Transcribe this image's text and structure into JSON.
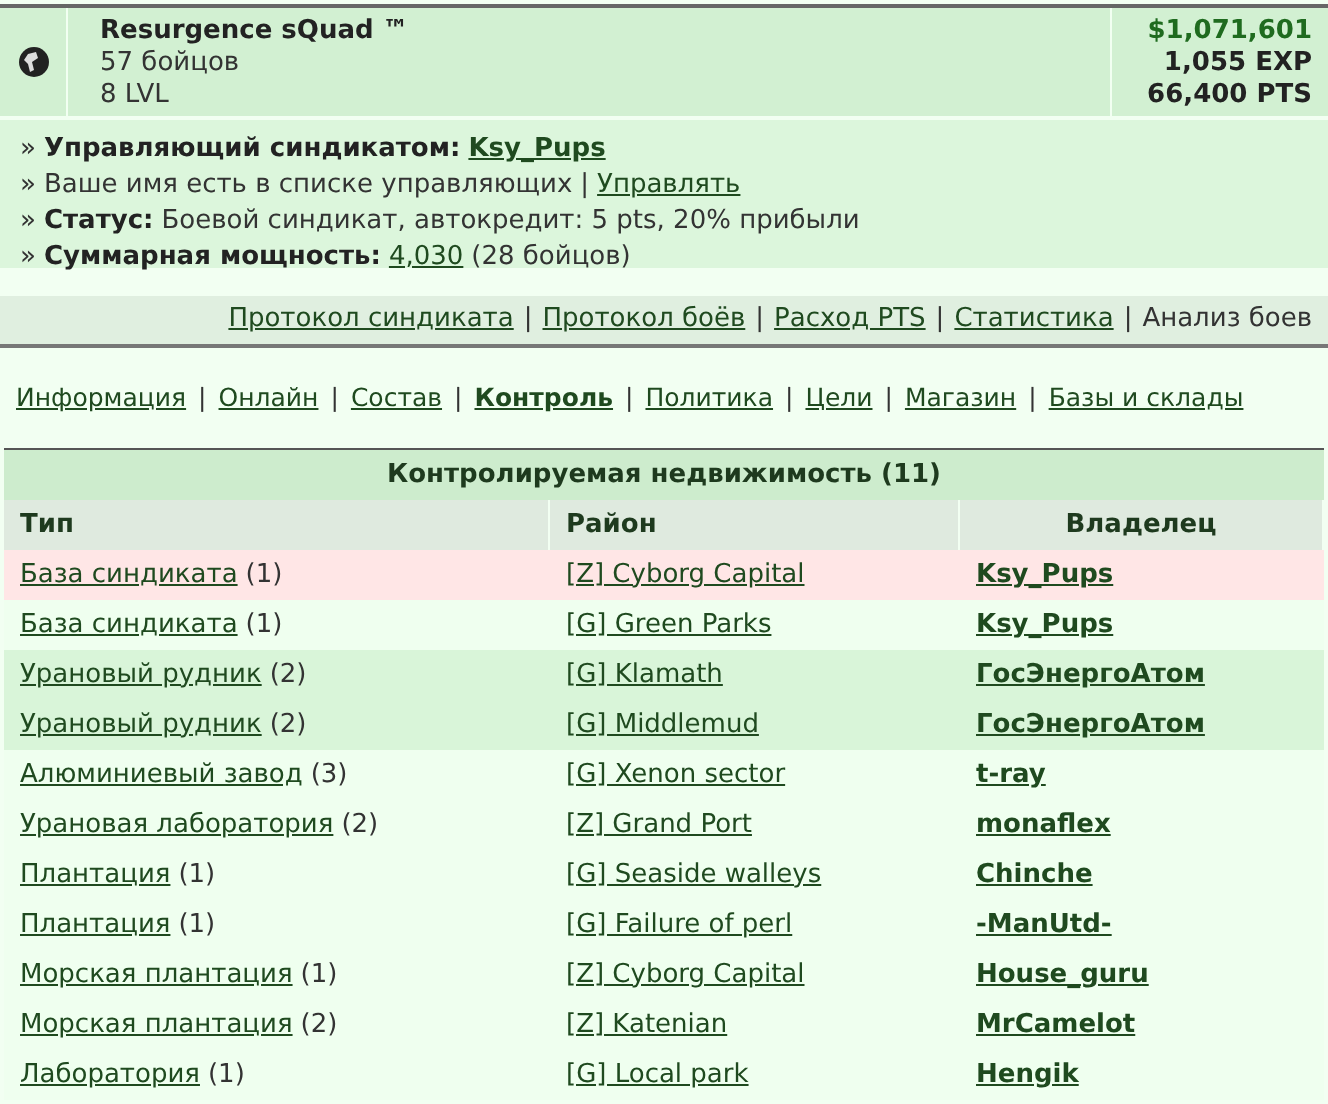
{
  "squad": {
    "name": "Resurgence sQuad ™",
    "fighters": "57 бойцов",
    "level": "8 LVL",
    "money": "$1,071,601",
    "exp": "1,055 EXP",
    "pts": "66,400 PTS"
  },
  "info": [
    {
      "kind": "manager",
      "bullet": "»",
      "label": "Управляющий синдикатом:",
      "link": "Ksy_Pups"
    },
    {
      "kind": "note",
      "bullet": "»",
      "text": "Ваше имя есть в списке управляющих",
      "separator": "|",
      "link": "Управлять"
    },
    {
      "kind": "status",
      "bullet": "»",
      "label": "Статус:",
      "text": "Боевой синдикат, автокредит: 5 pts, 20% прибыли"
    },
    {
      "kind": "power",
      "bullet": "»",
      "label": "Суммарная мощность:",
      "link": "4,030",
      "text": "(28 бойцов)"
    }
  ],
  "protocol_links": [
    {
      "label": "Протокол синдиката",
      "link": true
    },
    {
      "separator": "|",
      "label": "Протокол боёв",
      "link": true
    },
    {
      "separator": "|",
      "label": "Расход PTS",
      "link": true
    },
    {
      "separator": "|",
      "label": "Статистика",
      "link": true
    },
    {
      "separator": "|",
      "label": "Анализ боев",
      "link": false
    }
  ],
  "tabs": [
    {
      "label": "Информация",
      "selected": false
    },
    {
      "separator": "|",
      "label": "Онлайн",
      "selected": false
    },
    {
      "separator": "|",
      "label": "Состав",
      "selected": false
    },
    {
      "separator": "|",
      "label": "Контроль",
      "selected": true
    },
    {
      "separator": "|",
      "label": "Политика",
      "selected": false
    },
    {
      "separator": "|",
      "label": "Цели",
      "selected": false
    },
    {
      "separator": "|",
      "label": "Магазин",
      "selected": false
    },
    {
      "separator": "|",
      "label": "Базы и склады",
      "selected": false
    }
  ],
  "table": {
    "title": "Контролируемая недвижимость (11)",
    "columns": [
      "Тип",
      "Район",
      "Владелец"
    ],
    "rows": [
      {
        "type": "База синдиката",
        "count": "(1)",
        "district": "[Z] Cyborg Capital",
        "owner": "Ksy_Pups",
        "color": "#ffe6e6"
      },
      {
        "type": "База синдиката",
        "count": "(1)",
        "district": "[G] Green Parks",
        "owner": "Ksy_Pups",
        "color": "#efffef"
      },
      {
        "type": "Урановый рудник",
        "count": "(2)",
        "district": "[G] Klamath",
        "owner": "ГосЭнергоАтом",
        "color": "#d9f5d9"
      },
      {
        "type": "Урановый рудник",
        "count": "(2)",
        "district": "[G] Middlemud",
        "owner": "ГосЭнергоАтом",
        "color": "#d9f5d9"
      },
      {
        "type": "Алюминиевый завод",
        "count": "(3)",
        "district": "[G] Xenon sector",
        "owner": "t-ray",
        "color": "#efffef"
      },
      {
        "type": "Урановая лаборатория",
        "count": "(2)",
        "district": "[Z] Grand Port",
        "owner": "monaflex",
        "color": "#efffef"
      },
      {
        "type": "Плантация",
        "count": "(1)",
        "district": "[G] Seaside walleys",
        "owner": "Chinche",
        "color": "#efffef"
      },
      {
        "type": "Плантация",
        "count": "(1)",
        "district": "[G] Failure of perl",
        "owner": "-ManUtd-",
        "color": "#efffef"
      },
      {
        "type": "Морская плантация",
        "count": "(1)",
        "district": "[Z] Cyborg Capital",
        "owner": "House_guru",
        "color": "#efffef"
      },
      {
        "type": "Морская плантация",
        "count": "(2)",
        "district": "[Z] Katenian",
        "owner": "MrCamelot",
        "color": "#efffef"
      },
      {
        "type": "Лаборатория",
        "count": "(1)",
        "district": "[G] Local park",
        "owner": "Hengik",
        "color": "#efffef"
      }
    ]
  }
}
